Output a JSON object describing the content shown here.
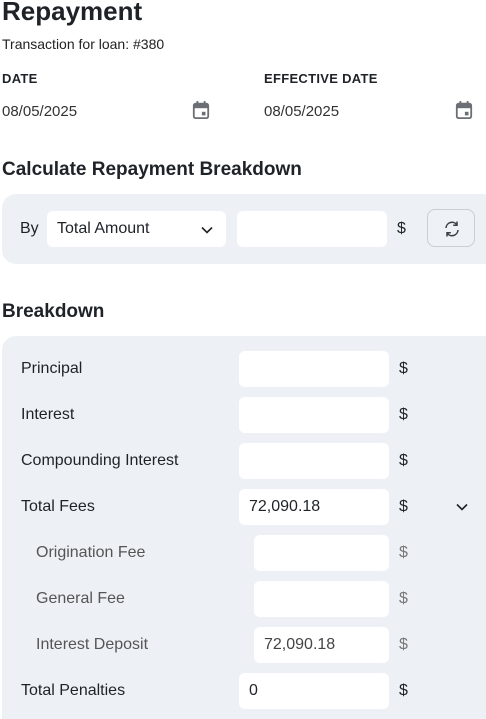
{
  "header": {
    "title": "Repayment",
    "subtitle": "Transaction for loan: #380"
  },
  "dates": {
    "date_label": "DATE",
    "date_value": "08/05/2025",
    "effective_label": "EFFECTIVE DATE",
    "effective_value": "08/05/2025",
    "icon": "calendar-icon"
  },
  "calculate": {
    "heading": "Calculate Repayment Breakdown",
    "by_label": "By",
    "by_selected": "Total Amount",
    "amount_value": "",
    "currency": "$",
    "refresh_icon": "refresh-icon"
  },
  "breakdown": {
    "heading": "Breakdown",
    "currency": "$",
    "rows": [
      {
        "label": "Principal",
        "value": "",
        "sub": false
      },
      {
        "label": "Interest",
        "value": "",
        "sub": false
      },
      {
        "label": "Compounding Interest",
        "value": "",
        "sub": false
      },
      {
        "label": "Total Fees",
        "value": "72,090.18",
        "sub": false,
        "expandable": true
      },
      {
        "label": "Origination Fee",
        "value": "",
        "sub": true
      },
      {
        "label": "General Fee",
        "value": "",
        "sub": true
      },
      {
        "label": "Interest Deposit",
        "value": "72,090.18",
        "sub": true
      },
      {
        "label": "Total Penalties",
        "value": "0",
        "sub": false
      }
    ]
  },
  "colors": {
    "panel_bg": "#edf1f6",
    "icon_gray": "#6b6f75"
  }
}
